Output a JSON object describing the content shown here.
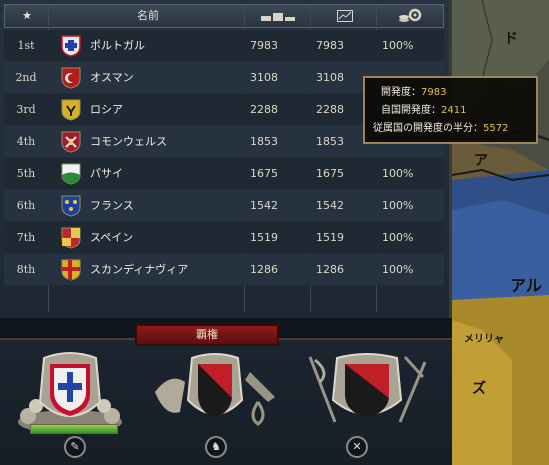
{
  "header": {
    "rank_icon": "star-icon",
    "name_label": "名前",
    "dev_icon": "development-bars-icon",
    "dev2_icon": "chart-icon",
    "pct_icon": "coins-gear-icon"
  },
  "rows": [
    {
      "rank": "1st",
      "name": "ポルトガル",
      "dev": "7983",
      "dev2": "7983",
      "pct": "100%",
      "flag": "portugal-shield"
    },
    {
      "rank": "2nd",
      "name": "オスマン",
      "dev": "3108",
      "dev2": "3108",
      "pct": "",
      "flag": "ottoman-shield"
    },
    {
      "rank": "3rd",
      "name": "ロシア",
      "dev": "2288",
      "dev2": "2288",
      "pct": "",
      "flag": "russia-shield"
    },
    {
      "rank": "4th",
      "name": "コモンウェルス",
      "dev": "1853",
      "dev2": "1853",
      "pct": "",
      "flag": "commonwealth-shield"
    },
    {
      "rank": "5th",
      "name": "パサイ",
      "dev": "1675",
      "dev2": "1675",
      "pct": "100%",
      "flag": "pasai-shield"
    },
    {
      "rank": "6th",
      "name": "フランス",
      "dev": "1542",
      "dev2": "1542",
      "pct": "100%",
      "flag": "france-shield"
    },
    {
      "rank": "7th",
      "name": "スペイン",
      "dev": "1519",
      "dev2": "1519",
      "pct": "100%",
      "flag": "spain-shield"
    },
    {
      "rank": "8th",
      "name": "スカンディナヴィア",
      "dev": "1286",
      "dev2": "1286",
      "pct": "100%",
      "flag": "scandinavia-shield"
    }
  ],
  "tooltip": {
    "l1_label": "開発度：",
    "l1_value": "7983",
    "l2_label": "自国開発度：",
    "l2_value": "2411",
    "l3_label": "従属国の開発度の半分：",
    "l3_value": "5572"
  },
  "hegemony": {
    "title": "覇権",
    "progress": 1.0,
    "crests": [
      "portugal-economic-crest",
      "military-crest",
      "naval-crest"
    ]
  },
  "map": {
    "labels": [
      "ド",
      "ア",
      "アル",
      "メリリャ",
      "ズ"
    ]
  }
}
